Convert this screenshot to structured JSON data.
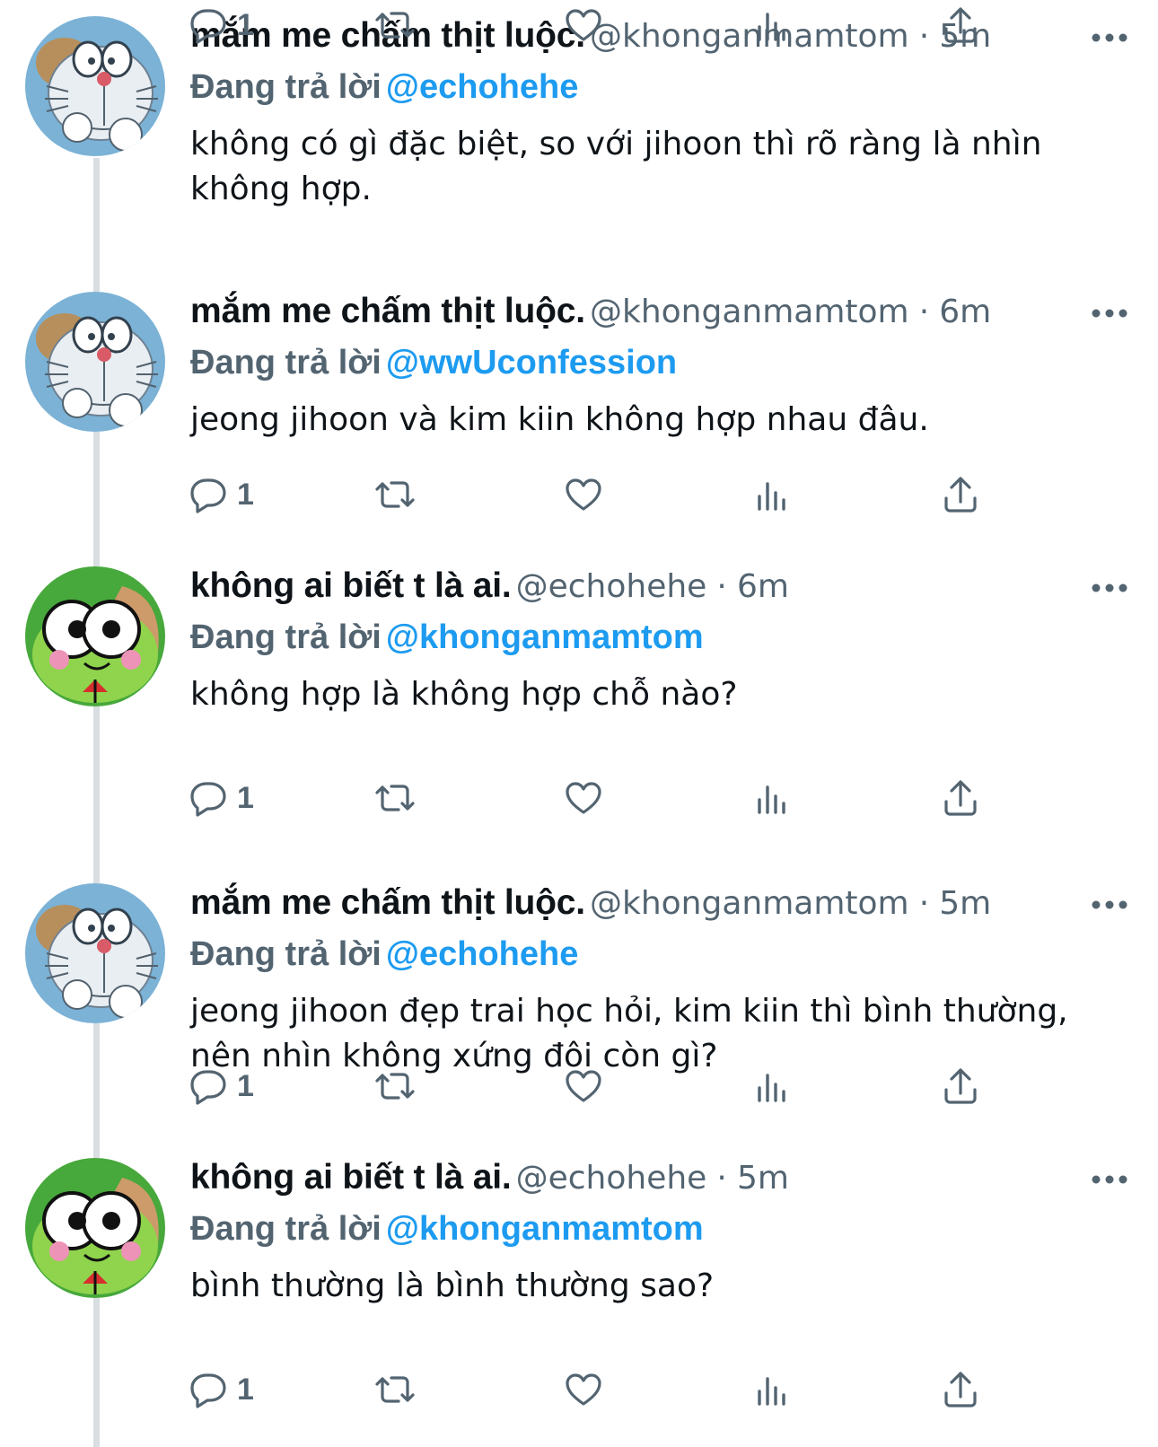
{
  "tweets": [
    {
      "display_name": "mắm me chấm thịt luộc.",
      "handle": "@khonganmamtom",
      "separator": "·",
      "time": "6m",
      "reply_prefix": "Đang trả lời",
      "reply_to": "@wwUconfession",
      "text": "jeong jihoon và kim kiin không hợp nhau đâu.",
      "reply_count": "1",
      "avatar": "doraemon-avatar"
    },
    {
      "display_name": "không ai biết t là ai.",
      "handle": "@echohehe",
      "separator": "·",
      "time": "6m",
      "reply_prefix": "Đang trả lời",
      "reply_to": "@khonganmamtom",
      "text": "không hợp là không hợp chỗ nào?",
      "reply_count": "1",
      "avatar": "keroppi-avatar"
    },
    {
      "display_name": "mắm me chấm thịt luộc.",
      "handle": "@khonganmamtom",
      "separator": "·",
      "time": "5m",
      "reply_prefix": "Đang trả lời",
      "reply_to": "@echohehe",
      "text": "jeong jihoon đẹp trai học hỏi, kim kiin thì bình thường, nên nhìn không xứng đôi còn gì?",
      "reply_count": "1",
      "avatar": "doraemon-avatar"
    },
    {
      "display_name": "không ai biết t là ai.",
      "handle": "@echohehe",
      "separator": "·",
      "time": "5m",
      "reply_prefix": "Đang trả lời",
      "reply_to": "@khonganmamtom",
      "text": "bình thường là bình thường sao?",
      "reply_count": "1",
      "avatar": "keroppi-avatar"
    },
    {
      "display_name": "mắm me chấm thịt luộc.",
      "handle": "@khonganmamtom",
      "separator": "·",
      "time": "5m",
      "reply_prefix": "Đang trả lời",
      "reply_to": "@echohehe",
      "text": "không có gì đặc biệt, so với jihoon thì rõ ràng là nhìn không hợp.",
      "reply_count": "1",
      "avatar": "doraemon-avatar"
    }
  ],
  "icons": {
    "reply": "reply-icon",
    "retweet": "retweet-icon",
    "like": "heart-icon",
    "views": "views-icon",
    "share": "share-icon",
    "more": "more-icon"
  },
  "colors": {
    "text": "#0f1419",
    "secondary": "#536471",
    "link": "#1d9bf0",
    "thread_line": "#d9dee2"
  }
}
